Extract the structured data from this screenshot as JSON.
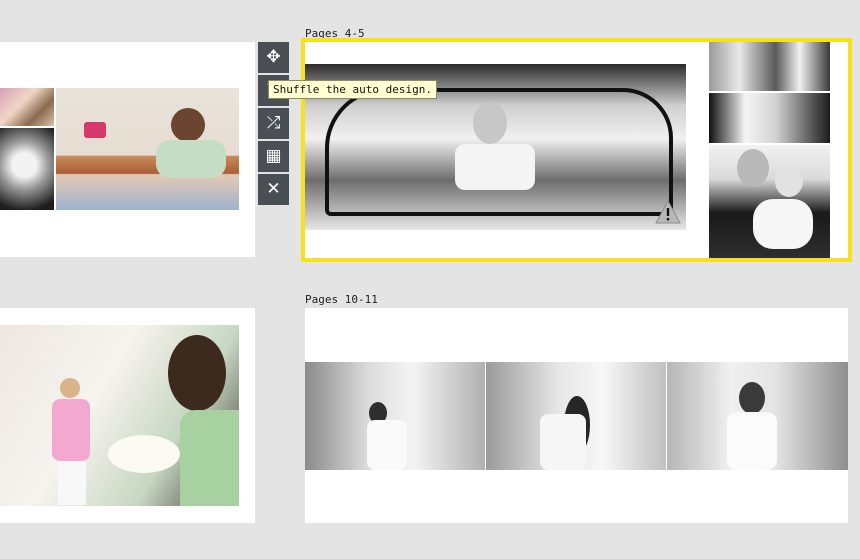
{
  "spreads": {
    "pages_4_5_label": "Pages 4-5",
    "pages_10_11_label": "Pages 10-11"
  },
  "toolbar": {
    "items": [
      {
        "icon": "move-icon",
        "glyph": "✥"
      },
      {
        "icon": "rotate-icon",
        "glyph": "↻"
      },
      {
        "icon": "shuffle-icon",
        "glyph": "⤮"
      },
      {
        "icon": "grid-icon",
        "glyph": "▦"
      },
      {
        "icon": "close-icon",
        "glyph": "✕"
      }
    ],
    "tooltip": "Shuffle the auto design."
  },
  "colors": {
    "selection": "#f5e11c",
    "toolbar": "#4a4f55",
    "tooltip_bg": "#ffffcf",
    "warning": "#f5b800"
  }
}
